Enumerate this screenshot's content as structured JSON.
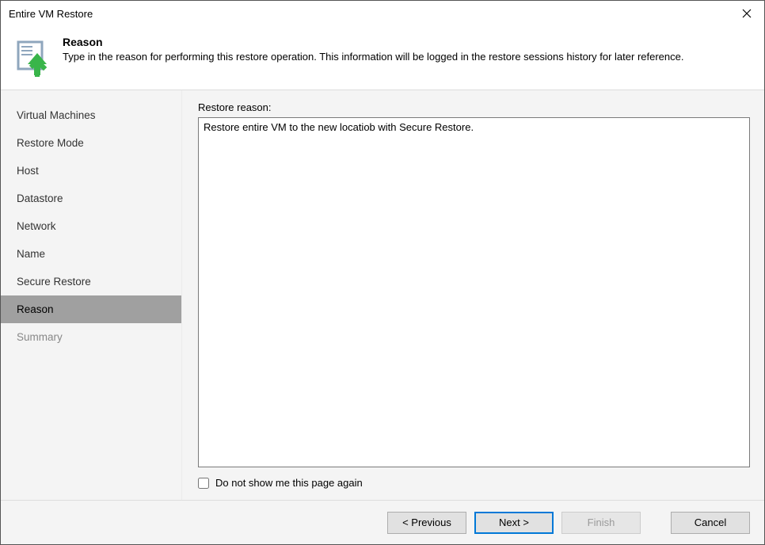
{
  "window": {
    "title": "Entire VM Restore"
  },
  "header": {
    "title": "Reason",
    "description": "Type in the reason for performing this restore operation. This information will be logged in the restore sessions history for later reference."
  },
  "sidebar": {
    "items": [
      {
        "label": "Virtual Machines",
        "active": false,
        "disabled": false
      },
      {
        "label": "Restore Mode",
        "active": false,
        "disabled": false
      },
      {
        "label": "Host",
        "active": false,
        "disabled": false
      },
      {
        "label": "Datastore",
        "active": false,
        "disabled": false
      },
      {
        "label": "Network",
        "active": false,
        "disabled": false
      },
      {
        "label": "Name",
        "active": false,
        "disabled": false
      },
      {
        "label": "Secure Restore",
        "active": false,
        "disabled": false
      },
      {
        "label": "Reason",
        "active": true,
        "disabled": false
      },
      {
        "label": "Summary",
        "active": false,
        "disabled": true
      }
    ]
  },
  "main": {
    "reason_label": "Restore reason:",
    "reason_value": "Restore entire VM to the new locatiob with Secure Restore.",
    "checkbox_label": "Do not show me this page again",
    "checkbox_checked": false
  },
  "footer": {
    "previous_label": "< Previous",
    "next_label": "Next >",
    "finish_label": "Finish",
    "cancel_label": "Cancel"
  }
}
